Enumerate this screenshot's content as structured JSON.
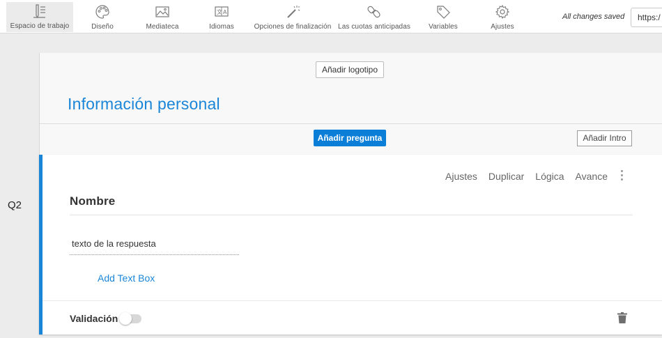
{
  "toolbar": {
    "items": [
      {
        "label": "Espacio de trabajo",
        "icon": "pencil-document-icon"
      },
      {
        "label": "Diseño",
        "icon": "palette-icon"
      },
      {
        "label": "Mediateca",
        "icon": "image-icon"
      },
      {
        "label": "Idiomas",
        "icon": "translate-icon"
      },
      {
        "label": "Opciones de finalización",
        "icon": "magic-wand-icon"
      },
      {
        "label": "Las cuotas anticipadas",
        "icon": "link-chain-icon"
      },
      {
        "label": "Variables",
        "icon": "tag-icon"
      },
      {
        "label": "Ajustes",
        "icon": "gear-icon"
      }
    ],
    "status": "All changes saved",
    "url_preview": "https:/"
  },
  "header": {
    "add_logo": "Añadir logotipo",
    "block_title": "Información personal",
    "add_question": "Añadir pregunta",
    "add_intro": "Añadir Intro"
  },
  "question": {
    "number": "Q2",
    "actions": [
      "Ajustes",
      "Duplicar",
      "Lógica",
      "Avance"
    ],
    "title": "Nombre",
    "answer_placeholder": "texto de la respuesta",
    "add_text_box": "Add Text Box",
    "validation_label": "Validación",
    "validation_enabled": false
  },
  "colors": {
    "accent": "#1b86d8",
    "button_primary": "#0b7fd8",
    "background": "#ececec"
  }
}
